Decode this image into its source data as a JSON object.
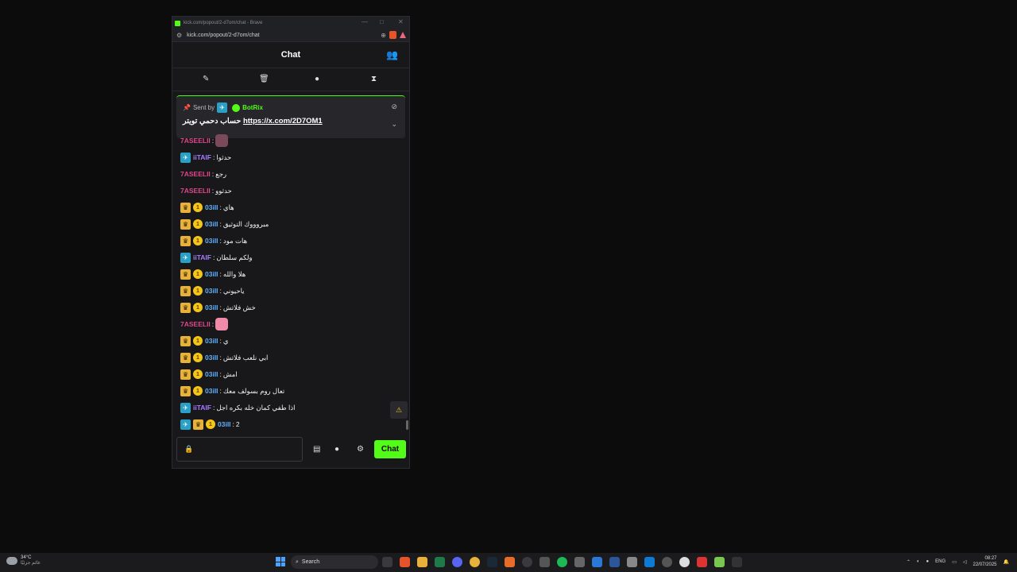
{
  "window": {
    "title": "kick.com/popout/2-d7om/chat - Brave",
    "url": "kick.com/popout/2-d7om/chat",
    "controls": {
      "minimize": "—",
      "maximize": "□",
      "close": "✕"
    }
  },
  "chat": {
    "header_title": "Chat",
    "mod_icons": [
      "pin-icon",
      "trash-icon",
      "chat-bubble-icon",
      "hourglass-icon"
    ]
  },
  "pinned": {
    "sent_by_label": "Sent by",
    "bot_name": "BotRix",
    "message_text": "حساب دحمي تويتر",
    "message_link": "https://x.com/2D7OM1"
  },
  "messages": [
    {
      "user": "7ASEELII",
      "color": "#e0468b",
      "badges": [],
      "text": "",
      "emote": "#7a4a5a"
    },
    {
      "user": "iiTAIF",
      "color": "#a77bff",
      "badges": [
        "bot"
      ],
      "text": "حدثوا"
    },
    {
      "user": "7ASEELII",
      "color": "#e0468b",
      "badges": [],
      "text": "رجع"
    },
    {
      "user": "7ASEELII",
      "color": "#e0468b",
      "badges": [],
      "text": "حدثوو"
    },
    {
      "user": "03ill",
      "color": "#5fb0ff",
      "badges": [
        "crown",
        "coin"
      ],
      "text": "هاي"
    },
    {
      "user": "03ill",
      "color": "#5fb0ff",
      "badges": [
        "crown",
        "coin"
      ],
      "text": "مبروووك التوثيق"
    },
    {
      "user": "03ill",
      "color": "#5fb0ff",
      "badges": [
        "crown",
        "coin"
      ],
      "text": "هات مود"
    },
    {
      "user": "iiTAIF",
      "color": "#a77bff",
      "badges": [
        "bot"
      ],
      "text": "ولكم سلطان"
    },
    {
      "user": "03ill",
      "color": "#5fb0ff",
      "badges": [
        "crown",
        "coin"
      ],
      "text": "هلا والله"
    },
    {
      "user": "03ill",
      "color": "#5fb0ff",
      "badges": [
        "crown",
        "coin"
      ],
      "text": "ياحيوني"
    },
    {
      "user": "03ill",
      "color": "#5fb0ff",
      "badges": [
        "crown",
        "coin"
      ],
      "text": "خش فلاتش"
    },
    {
      "user": "7ASEELII",
      "color": "#e0468b",
      "badges": [],
      "text": "",
      "emote": "#f08aa8"
    },
    {
      "user": "03ill",
      "color": "#5fb0ff",
      "badges": [
        "crown",
        "coin"
      ],
      "text": "ي"
    },
    {
      "user": "03ill",
      "color": "#5fb0ff",
      "badges": [
        "crown",
        "coin"
      ],
      "text": "ابي نلعب فلاتش"
    },
    {
      "user": "03ill",
      "color": "#5fb0ff",
      "badges": [
        "crown",
        "coin"
      ],
      "text": "امش"
    },
    {
      "user": "03ill",
      "color": "#5fb0ff",
      "badges": [
        "crown",
        "coin"
      ],
      "text": "تعال روم بسولف معك"
    },
    {
      "user": "iiTAIF",
      "color": "#a77bff",
      "badges": [
        "bot"
      ],
      "text": "اذا طفي كمان خله بكره اجل"
    },
    {
      "user": "03ill",
      "color": "#5fb0ff",
      "badges": [
        "bot",
        "crown",
        "coin"
      ],
      "text": "2"
    }
  ],
  "composer": {
    "send_label": "Chat"
  },
  "taskbar": {
    "weather_temp": "34°C",
    "weather_desc": "غائم جزئيًا",
    "search_label": "Search",
    "lang": "ENG",
    "time": "08:27",
    "date": "22/07/2025"
  }
}
